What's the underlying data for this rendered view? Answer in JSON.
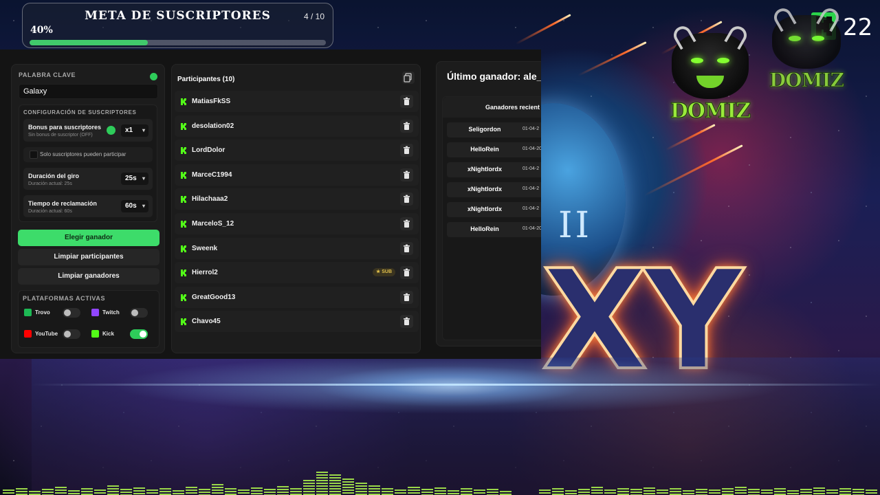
{
  "goal": {
    "title": "META DE SUSCRIPTORES",
    "count": "4 / 10",
    "percent_label": "40%",
    "progress_fraction": 0.4,
    "accent": "#41c96b"
  },
  "overlay": {
    "kick_number": "22",
    "logo_text": "DOMIZ",
    "background_text": "XY",
    "background_glyph": "II"
  },
  "left": {
    "keyword_label": "PALABRA CLAVE",
    "keyword_value": "Galaxy",
    "sub_config_title": "CONFIGURACIÓN DE SUSCRIPTORES",
    "bonus": {
      "title": "Bonus para suscriptores",
      "sub": "Sin bonus de suscriptor (OFF)",
      "value": "x1"
    },
    "only_subs": "Solo suscriptores pueden participar",
    "spin": {
      "title": "Duración del giro",
      "sub": "Duración actual: 25s",
      "value": "25s"
    },
    "claim": {
      "title": "Tiempo de reclamación",
      "sub": "Duración actual: 60s",
      "value": "60s"
    },
    "btn_pick": "Elegir ganador",
    "btn_clear_participants": "Limpiar participantes",
    "btn_clear_winners": "Limpiar ganadores",
    "platforms_title": "PLATAFORMAS ACTIVAS",
    "platforms": [
      {
        "name": "Trovo",
        "enabled": false,
        "color": "#1db954"
      },
      {
        "name": "Twitch",
        "enabled": false,
        "color": "#9146ff"
      },
      {
        "name": "YouTube",
        "enabled": false,
        "color": "#ff0000"
      },
      {
        "name": "Kick",
        "enabled": true,
        "color": "#53fc18"
      }
    ]
  },
  "participants": {
    "title": "Participantes (10)",
    "sub_badge": "SUB",
    "items": [
      {
        "name": "MatiasFkSS",
        "sub": false
      },
      {
        "name": "desolation02",
        "sub": false
      },
      {
        "name": "LordDolor",
        "sub": false
      },
      {
        "name": "MarceC1994",
        "sub": false
      },
      {
        "name": "Hilachaaa2",
        "sub": false
      },
      {
        "name": "MarceloS_12",
        "sub": false
      },
      {
        "name": "Sweenk",
        "sub": false
      },
      {
        "name": "Hierrol2",
        "sub": true
      },
      {
        "name": "GreatGood13",
        "sub": false
      },
      {
        "name": "Chavo45",
        "sub": false
      }
    ]
  },
  "winners": {
    "last_winner": "Último ganador: ale_",
    "recent_title": "Ganadores recient",
    "items": [
      {
        "name": "Seligordon",
        "date": "01-04-2"
      },
      {
        "name": "HelloRein",
        "date": "01-04-20"
      },
      {
        "name": "xNightlordx",
        "date": "01-04-2"
      },
      {
        "name": "xNightlordx",
        "date": "01-04-2"
      },
      {
        "name": "xNightlordx",
        "date": "01-04-2"
      },
      {
        "name": "HelloRein",
        "date": "01-04-20"
      }
    ]
  }
}
